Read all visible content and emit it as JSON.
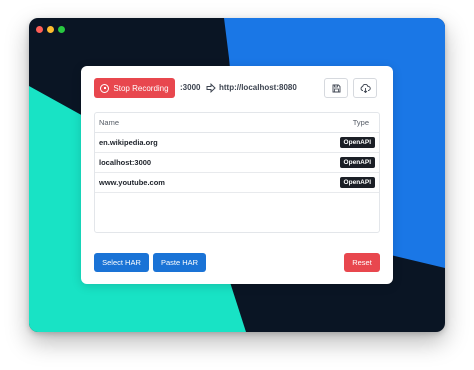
{
  "window": {
    "traffic_lights": [
      "close",
      "minimize",
      "zoom"
    ]
  },
  "toolbar": {
    "stop_label": "Stop Recording",
    "port": ":3000",
    "proxy_url": "http://localhost:8080",
    "icons": [
      "stop-circle-icon",
      "arrow-right-icon",
      "save-icon",
      "cloud-download-icon"
    ]
  },
  "table": {
    "columns": [
      "Name",
      "Type"
    ],
    "rows": [
      {
        "name": "en.wikipedia.org",
        "type": "OpenAPI"
      },
      {
        "name": "localhost:3000",
        "type": "OpenAPI"
      },
      {
        "name": "www.youtube.com",
        "type": "OpenAPI"
      }
    ]
  },
  "actions": {
    "select_har": "Select HAR",
    "paste_har": "Paste HAR",
    "reset": "Reset"
  },
  "colors": {
    "danger": "#e8474e",
    "primary": "#1a73d6",
    "badge": "#1b1f26",
    "bg_dark": "#0a1524",
    "bg_blue": "#1a77e6",
    "bg_teal": "#18e3c5"
  }
}
